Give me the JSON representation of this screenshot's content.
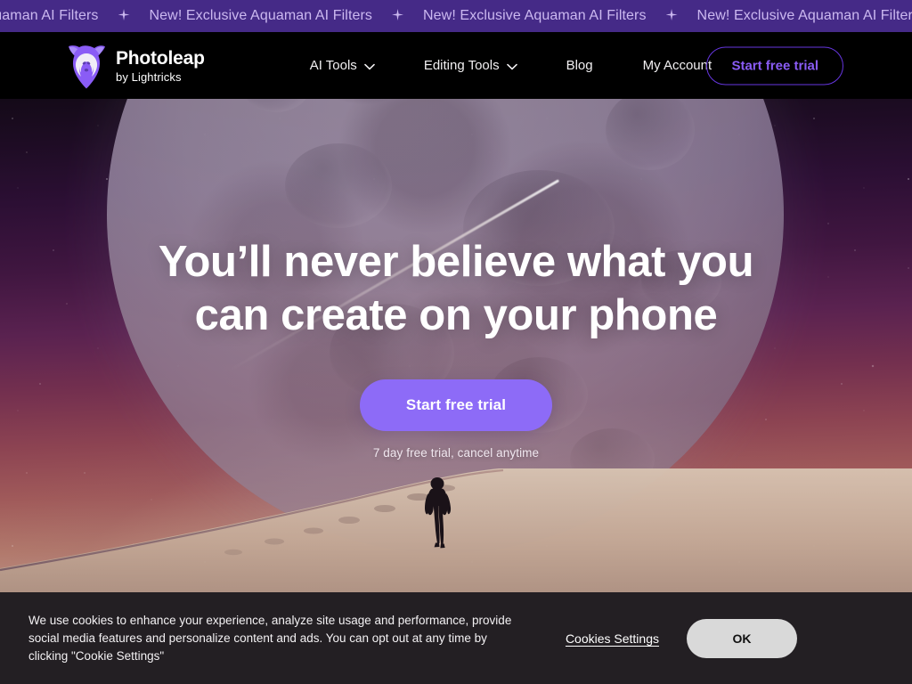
{
  "banner": {
    "message": "New! Exclusive Aquaman AI Filters",
    "separator_icon": "sparkle-icon",
    "background_color": "#452a87",
    "text_color": "#cbb8f0"
  },
  "header": {
    "logo": {
      "icon": "fox-logo-icon",
      "name": "Photoleap",
      "subtitle": "by Lightricks"
    },
    "nav": [
      {
        "label": "AI Tools",
        "has_dropdown": true
      },
      {
        "label": "Editing Tools",
        "has_dropdown": true
      },
      {
        "label": "Blog",
        "has_dropdown": false
      },
      {
        "label": "My Account",
        "has_dropdown": false
      }
    ],
    "cta_label": "Start free trial",
    "cta_border_color": "#6636e0",
    "cta_text_color": "#8a5cf6",
    "background_color": "#000000"
  },
  "hero": {
    "headline_line1": "You’ll never believe what you",
    "headline_line2": "can create on your phone",
    "cta_label": "Start free trial",
    "cta_background": "#8d6bf7",
    "note": "7 day free trial, cancel anytime",
    "scene": {
      "description": "Night desert dune with large moon, starry purple-to-pink sky, shooting star and a walking silhouette",
      "moon": "moon-graphic",
      "meteor": "shooting-star-graphic",
      "figure": "walking-person-silhouette"
    }
  },
  "cookie_banner": {
    "text": "We use cookies to enhance your experience, analyze site usage and performance, provide social media features and personalize content and ads. You can opt out at any time by clicking \"Cookie Settings\"",
    "settings_label": "Cookies Settings",
    "ok_label": "OK",
    "background_color": "#231f23",
    "ok_background": "#d9d9d9"
  }
}
